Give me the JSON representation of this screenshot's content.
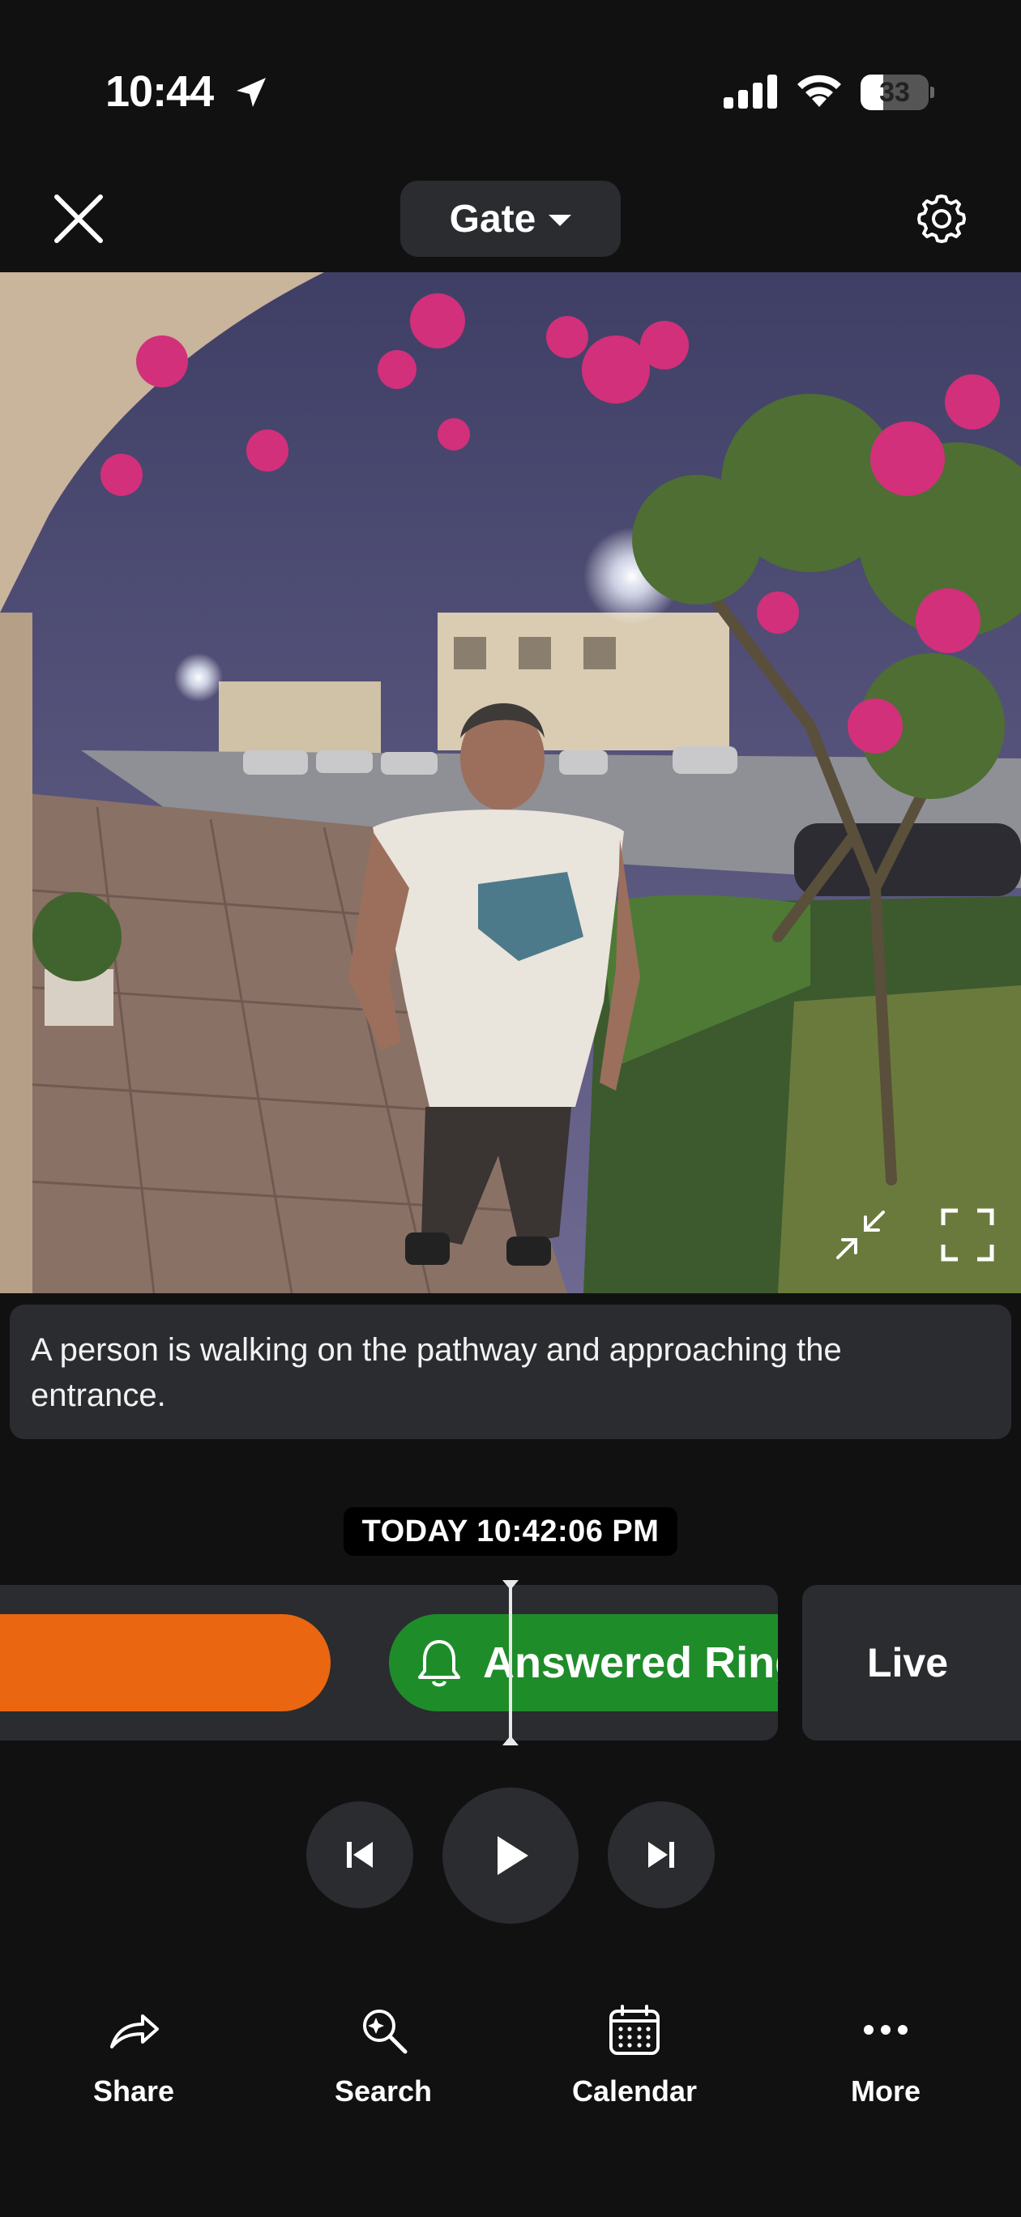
{
  "status_bar": {
    "time": "10:44",
    "battery_level": "33",
    "battery_fraction": 0.33
  },
  "header": {
    "camera_name": "Gate",
    "close_icon": "close-icon",
    "settings_icon": "gear-icon"
  },
  "video": {
    "minimize_icon": "minimize-icon",
    "fullscreen_icon": "fullscreen-icon"
  },
  "event_description": "A person is walking on the pathway and approaching the entrance.",
  "timeline": {
    "timestamp": "TODAY 10:42:06 PM",
    "events": [
      {
        "type": "motion",
        "color": "#ea6611"
      },
      {
        "type": "ring",
        "label": "Answered Ring",
        "icon": "bell-icon",
        "color": "#1f8c2a"
      }
    ],
    "live_label": "Live"
  },
  "playback": {
    "prev_icon": "skip-previous-icon",
    "play_icon": "play-icon",
    "next_icon": "skip-next-icon"
  },
  "toolbar": {
    "share_label": "Share",
    "search_label": "Search",
    "calendar_label": "Calendar",
    "more_label": "More"
  },
  "colors": {
    "background": "#111112",
    "surface": "#2a2c30",
    "motion_event": "#ea6611",
    "ring_event": "#1f8c2a"
  }
}
